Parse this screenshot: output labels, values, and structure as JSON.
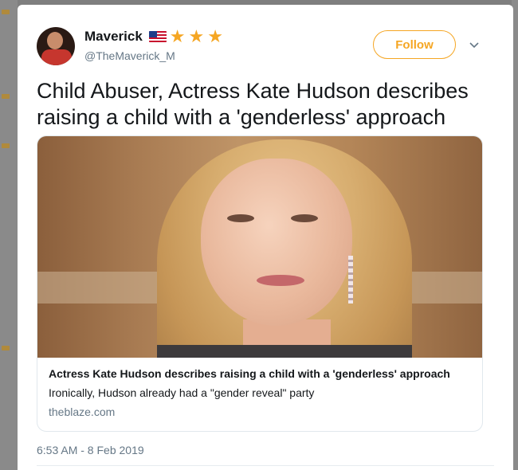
{
  "tweet": {
    "author": {
      "name": "Maverick",
      "handle": "@TheMaverick_M",
      "badges": [
        "us-flag-icon",
        "star-icon",
        "star-icon",
        "star-icon"
      ]
    },
    "follow_label": "Follow",
    "text": "Child Abuser, Actress Kate Hudson describes raising a child with a 'genderless' approach",
    "link_card": {
      "title": "Actress Kate Hudson describes raising a child with a 'genderless' approach",
      "description": "Ironically, Hudson already had a \"gender reveal\" party",
      "domain": "theblaze.com"
    },
    "timestamp": "6:53 AM - 8 Feb 2019"
  },
  "colors": {
    "accent": "#f5a623",
    "text": "#14171a",
    "secondary": "#657786",
    "border": "#e1e8ed",
    "overlay": "#7f7f7f"
  }
}
